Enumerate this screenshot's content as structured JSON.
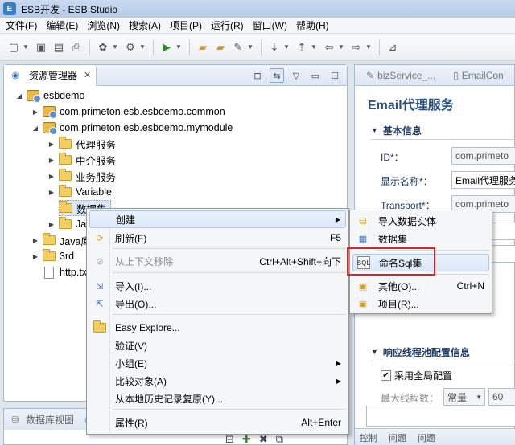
{
  "window": {
    "title": "ESB开发 - ESB Studio"
  },
  "menubar": [
    "文件(F)",
    "编辑(E)",
    "浏览(N)",
    "搜索(A)",
    "项目(P)",
    "运行(R)",
    "窗口(W)",
    "帮助(H)"
  ],
  "left_view": {
    "tab_label": "资源管理器",
    "tree": [
      {
        "label": "esbdemo",
        "level": 0
      },
      {
        "label": "com.primeton.esb.esbdemo.common",
        "level": 1
      },
      {
        "label": "com.primeton.esb.esbdemo.mymodule",
        "level": 1
      },
      {
        "label": "代理服务",
        "level": 2
      },
      {
        "label": "中介服务",
        "level": 2
      },
      {
        "label": "业务服务",
        "level": 2
      },
      {
        "label": "Variable",
        "level": 2
      },
      {
        "label": "数据集",
        "level": 2
      },
      {
        "label": "Jav",
        "level": 2
      },
      {
        "label": "Java库",
        "level": 1
      },
      {
        "label": "3rd",
        "level": 1
      },
      {
        "label": "http.tx",
        "level": 1
      }
    ]
  },
  "bottom_left": {
    "tab_label": "数据库视图"
  },
  "context_menu": {
    "items": [
      {
        "label": "创建",
        "shortcut": "",
        "submenu": true
      },
      {
        "label": "刷新(F)",
        "shortcut": "F5"
      },
      {
        "label": "从上下文移除",
        "shortcut": "Ctrl+Alt+Shift+向下",
        "disabled": true
      },
      {
        "label": "导入(I)...",
        "shortcut": ""
      },
      {
        "label": "导出(O)...",
        "shortcut": ""
      },
      {
        "label": "Easy Explore...",
        "shortcut": ""
      },
      {
        "label": "验证(V)",
        "shortcut": ""
      },
      {
        "label": "小组(E)",
        "shortcut": "",
        "submenu": true
      },
      {
        "label": "比较对象(A)",
        "shortcut": "",
        "submenu": true
      },
      {
        "label": "从本地历史记录复原(Y)...",
        "shortcut": ""
      },
      {
        "label": "属性(R)",
        "shortcut": "Alt+Enter"
      }
    ]
  },
  "submenu": {
    "items": [
      {
        "label": "导入数据实体",
        "shortcut": ""
      },
      {
        "label": "数据集",
        "shortcut": ""
      },
      {
        "label": "命名Sql集",
        "shortcut": ""
      },
      {
        "label": "其他(O)...",
        "shortcut": "Ctrl+N"
      },
      {
        "label": "项目(R)...",
        "shortcut": ""
      }
    ]
  },
  "editor": {
    "tabs": [
      "bizService_...",
      "EmailCon"
    ],
    "title": "Email代理服务",
    "section_basic": "基本信息",
    "fields": [
      {
        "label": "ID*：",
        "value": "com.primeto"
      },
      {
        "label": "显示名称*：",
        "value": "Email代理服务"
      },
      {
        "label": "Transport*：",
        "value": "com.primeto"
      }
    ],
    "section_pool": "响应线程池配置信息",
    "use_global_label": "采用全局配置",
    "max_threads_label": "最大线程数：",
    "max_threads_mode": "常量",
    "max_threads_value": "60",
    "bottom_tabs": [
      "控制",
      "问题",
      "问题"
    ]
  },
  "colors": {
    "highlight_border": "#e02020",
    "accent": "#2b4f7e"
  }
}
